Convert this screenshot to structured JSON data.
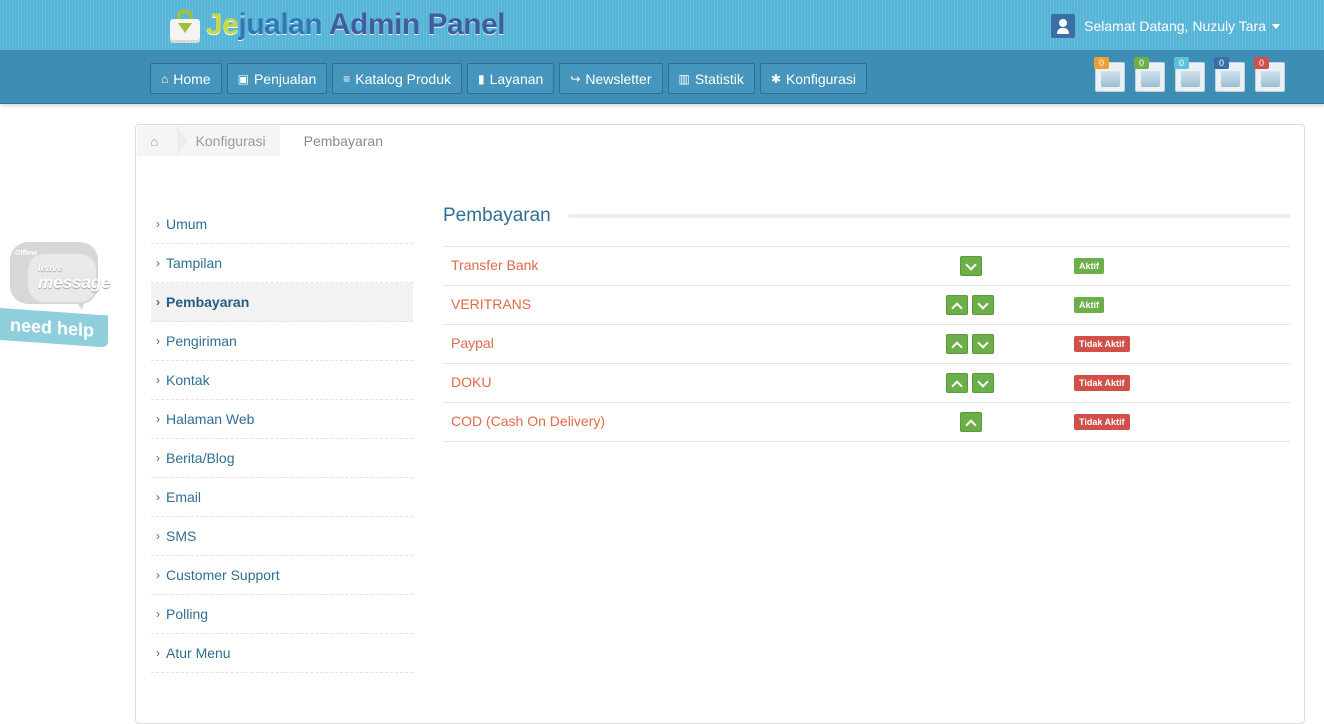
{
  "header": {
    "logo_part1": "Je",
    "logo_part2": "jualan",
    "logo_part3": "Admin Panel",
    "user_greeting": "Selamat Datang, Nuzuly Tara"
  },
  "nav": {
    "items": [
      {
        "label": "Home",
        "icon": "home-icon"
      },
      {
        "label": "Penjualan",
        "icon": "inbox-icon"
      },
      {
        "label": "Katalog Produk",
        "icon": "list-icon"
      },
      {
        "label": "Layanan",
        "icon": "bookmark-icon"
      },
      {
        "label": "Newsletter",
        "icon": "share-icon"
      },
      {
        "label": "Statistik",
        "icon": "bar-chart-icon"
      },
      {
        "label": "Konfigurasi",
        "icon": "gear-icon"
      }
    ],
    "notifications": [
      {
        "count": "0",
        "color": "#f0a030",
        "icon": "order-icon"
      },
      {
        "count": "0",
        "color": "#6cae4a",
        "icon": "alert-cart-icon"
      },
      {
        "count": "0",
        "color": "#5bc0de",
        "icon": "basket-icon"
      },
      {
        "count": "0",
        "color": "#3a6ea5",
        "icon": "customer-icon"
      },
      {
        "count": "0",
        "color": "#d2504a",
        "icon": "message-icon"
      }
    ]
  },
  "breadcrumb": {
    "items": [
      "Konfigurasi",
      "Pembayaran"
    ]
  },
  "sidebar": {
    "items": [
      {
        "label": "Umum"
      },
      {
        "label": "Tampilan"
      },
      {
        "label": "Pembayaran",
        "active": true
      },
      {
        "label": "Pengiriman"
      },
      {
        "label": "Kontak"
      },
      {
        "label": "Halaman Web"
      },
      {
        "label": "Berita/Blog"
      },
      {
        "label": "Email"
      },
      {
        "label": "SMS"
      },
      {
        "label": "Customer Support"
      },
      {
        "label": "Polling"
      },
      {
        "label": "Atur Menu"
      }
    ]
  },
  "main": {
    "title": "Pembayaran",
    "rows": [
      {
        "name": "Transfer Bank",
        "up": false,
        "down": true,
        "status": "Aktif"
      },
      {
        "name": "VERITRANS",
        "up": true,
        "down": true,
        "status": "Aktif"
      },
      {
        "name": "Paypal",
        "up": true,
        "down": true,
        "status": "Tidak Aktif"
      },
      {
        "name": "DOKU",
        "up": true,
        "down": true,
        "status": "Tidak Aktif"
      },
      {
        "name": "COD (Cash On Delivery)",
        "up": true,
        "down": false,
        "status": "Tidak Aktif"
      }
    ]
  },
  "help_widget": {
    "offline": "Offline",
    "leave": "leave",
    "message": "message",
    "need_help": "need help ?"
  },
  "colors": {
    "header_bg": "#56b4d8",
    "nav_bg": "#3e8db5",
    "link": "#2f6f95",
    "payment_name": "#e06a4a",
    "active_badge": "#6cae4a",
    "inactive_badge": "#d2504a"
  }
}
